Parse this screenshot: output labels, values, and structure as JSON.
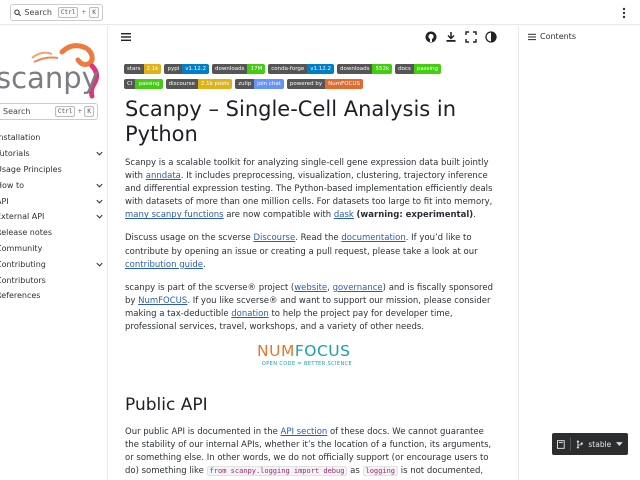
{
  "header": {
    "search_label": "Search",
    "search_shortcut_mod": "Ctrl",
    "search_shortcut_plus": "+",
    "search_shortcut_key": "K"
  },
  "sidebar": {
    "logo_text": "scanpy",
    "search_label": "Search",
    "search_shortcut_mod": "Ctrl",
    "search_shortcut_plus": "+",
    "search_shortcut_key": "K",
    "items": [
      {
        "label": "Installation",
        "expandable": false
      },
      {
        "label": "Tutorials",
        "expandable": true
      },
      {
        "label": "Usage Principles",
        "expandable": false
      },
      {
        "label": "How to",
        "expandable": true
      },
      {
        "label": "API",
        "expandable": true
      },
      {
        "label": "External API",
        "expandable": true
      },
      {
        "label": "Release notes",
        "expandable": false
      },
      {
        "label": "Community",
        "expandable": false
      },
      {
        "label": "Contributing",
        "expandable": true
      },
      {
        "label": "Contributors",
        "expandable": false
      },
      {
        "label": "References",
        "expandable": false
      }
    ]
  },
  "toc": {
    "title": "Contents"
  },
  "badges": {
    "row1": [
      {
        "left": "stars",
        "right": "2.1k",
        "color": "#dfb317",
        "icon": true
      },
      {
        "left": "pypi",
        "right": "v1.12.2",
        "color": "#007ec6",
        "icon": false
      },
      {
        "left": "downloads",
        "right": "17M",
        "color": "#4c1",
        "icon": true
      },
      {
        "left": "conda-forge",
        "right": "v1.12.2",
        "color": "#007ec6",
        "icon": false
      },
      {
        "left": "downloads",
        "right": "552k",
        "color": "#4c1",
        "icon": true
      },
      {
        "left": "docs",
        "right": "passing",
        "color": "#4c1",
        "icon": false
      }
    ],
    "row2": [
      {
        "left": "CI",
        "right": "passing",
        "color": "#4c1",
        "icon": true
      },
      {
        "left": "discourse",
        "right": "2.1k posts",
        "color": "#dfb317",
        "icon": true
      },
      {
        "left": "zulip",
        "right": "join chat",
        "color": "#6492fe",
        "icon": false
      },
      {
        "left": "powered by",
        "right": "NumFOCUS",
        "color": "#e06c2f",
        "icon": false
      }
    ]
  },
  "article": {
    "title": "Scanpy – Single-Cell Analysis in Python",
    "p1": {
      "a": "Scanpy is a scalable toolkit for analyzing single-cell gene expression data built jointly with ",
      "link1": "anndata",
      "b": ". It includes preprocessing, visualization, clustering, trajectory inference and differential expression testing. The Python-based implementation efficiently deals with datasets of more than one million cells. For datasets too large to fit into memory, ",
      "link2": "many scanpy functions",
      "c": " are now compatible with ",
      "link3": "dask",
      "d": " ",
      "strong": "(warning: experimental)",
      "e": "."
    },
    "p2": {
      "a": "Discuss usage on the scverse ",
      "link1": "Discourse",
      "b": ". Read the ",
      "link2": "documentation",
      "c": ". If you’d like to contribute by opening an issue or creating a pull request, please take a look at our ",
      "link3": "contribution guide",
      "d": "."
    },
    "p3": {
      "a": "scanpy is part of the scverse® project (",
      "link1": "website",
      "b": ", ",
      "link2": "governance",
      "c": ") and is fiscally sponsored by ",
      "link3": "NumFOCUS",
      "d": ". If you like scverse® and want to support our mission, please consider making a tax-deductible ",
      "link4": "donation",
      "e": " to help the project pay for developer time, professional services, travel, workshops, and a variety of other needs."
    },
    "numfocus": {
      "num": "NUM",
      "focus": "FOCUS",
      "tagline": "OPEN CODE = BETTER SCIENCE"
    },
    "h2": "Public API",
    "p4": {
      "a": "Our public API is documented in the ",
      "link1": "API section",
      "b": " of these docs. We cannot guarantee the stability of our internal APIs, whether it’s the location of a function, its arguments, or something else. In other words, we do not officially support (or encourage users to do) something like ",
      "code1": "from scanpy.logging import debug",
      "c": " as ",
      "code2": "logging",
      "d": " is not documented, even"
    }
  },
  "version": {
    "label": "stable"
  },
  "colors": {
    "link": "#2a5db0",
    "version_bg": "#2b2d2f",
    "numfocus_orange": "#e5762a",
    "numfocus_teal": "#1aa1a6"
  }
}
